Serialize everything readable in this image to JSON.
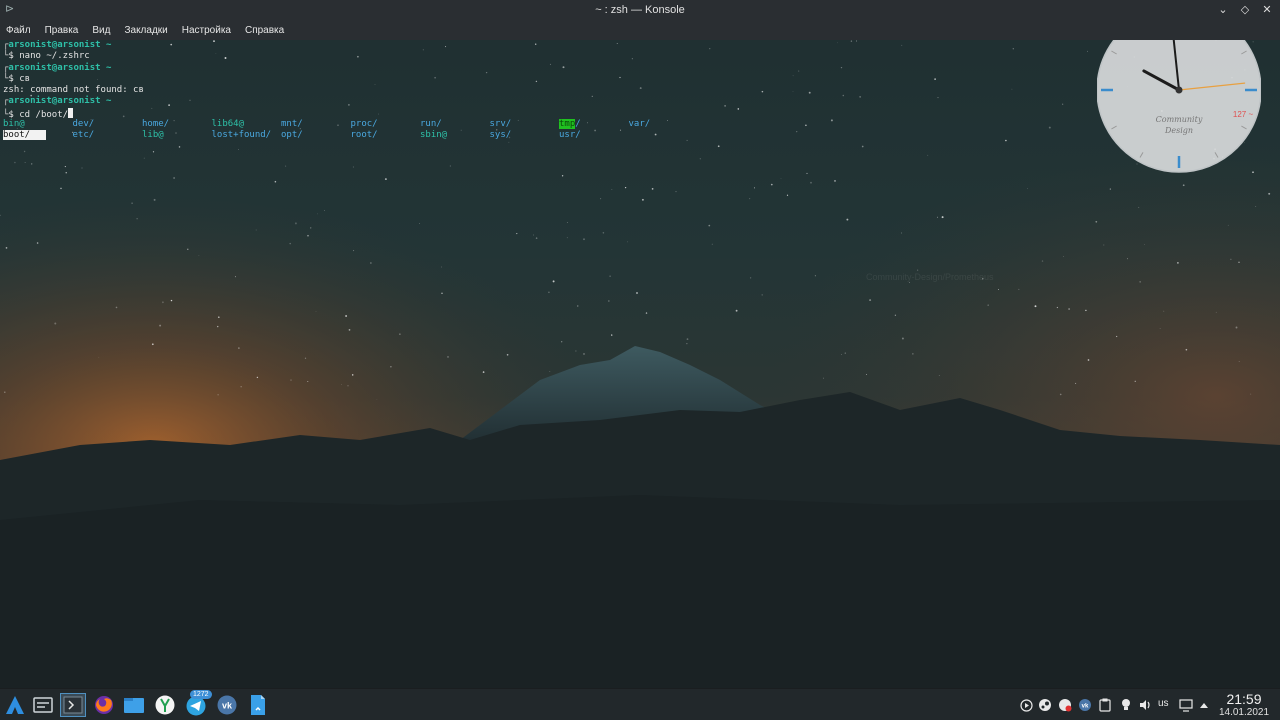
{
  "window": {
    "title": "~ : zsh — Konsole"
  },
  "menu": [
    "Файл",
    "Правка",
    "Вид",
    "Закладки",
    "Настройка",
    "Справка"
  ],
  "terminal": {
    "user": "arsonist@arsonist ~",
    "prompt_symbol": "$",
    "cmd1": "nano ~/.zshrc",
    "cmd2": "cв",
    "error": "zsh: command not found: cв",
    "cmd3": "cd /boot/",
    "ls_row1": [
      {
        "text": "bin@",
        "kind": "link"
      },
      {
        "text": "dev/",
        "kind": "dir"
      },
      {
        "text": "home/",
        "kind": "dir"
      },
      {
        "text": "lib64@",
        "kind": "link"
      },
      {
        "text": "mnt/",
        "kind": "dir"
      },
      {
        "text": "proc/",
        "kind": "dir"
      },
      {
        "text": "run/",
        "kind": "dir"
      },
      {
        "text": "srv/",
        "kind": "dir"
      },
      {
        "text": "tmp",
        "kind": "tmp",
        "suffix": "/"
      },
      {
        "text": "var/",
        "kind": "dir"
      }
    ],
    "ls_row2": [
      {
        "text": "boot/",
        "kind": "sel"
      },
      {
        "text": "etc/",
        "kind": "dir"
      },
      {
        "text": "lib@",
        "kind": "link"
      },
      {
        "text": "lost+found/",
        "kind": "dir"
      },
      {
        "text": "opt/",
        "kind": "dir"
      },
      {
        "text": "root/",
        "kind": "dir"
      },
      {
        "text": "sbin@",
        "kind": "link"
      },
      {
        "text": "sys/",
        "kind": "dir"
      },
      {
        "text": "usr/",
        "kind": "dir"
      }
    ]
  },
  "clock_widget": {
    "brand_line1": "Community",
    "brand_line2": "Design",
    "badge": "127 ~",
    "hour": 9.95,
    "minute": 59,
    "second": 14,
    "accent_color": "#e8a040"
  },
  "watermark": "Community-Design/Prometheus",
  "taskbar": {
    "apps": [
      "application-launcher-icon",
      "virtual-desktop-icon",
      "konsole-icon",
      "firefox-icon",
      "file-manager-icon",
      "yandex-browser-icon",
      "telegram-icon",
      "vk-icon",
      "document-icon"
    ],
    "telegram_badge": "1272",
    "tray_icons": [
      "media-play-icon",
      "steam-icon",
      "notification-icon",
      "vk-tray-icon",
      "clipboard-icon",
      "lightbulb-icon",
      "volume-icon",
      "display-icon",
      "expand-tray-icon"
    ],
    "language": "us",
    "time": "21:59",
    "date": "14.01.2021"
  },
  "colors": {
    "panel": "#22282b",
    "titlebar": "#2a2e32",
    "prompt": "#2ec0a8",
    "dir": "#4aa8e0",
    "tmp_highlight": "#20c020"
  }
}
